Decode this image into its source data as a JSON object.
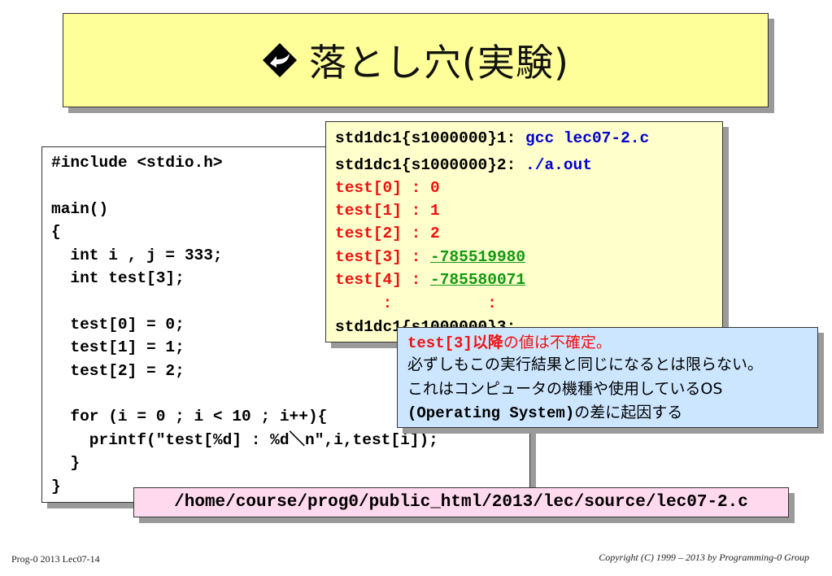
{
  "title": {
    "text": "落とし穴(実験)",
    "icon": "diamond-arrow-icon"
  },
  "code": {
    "lines": [
      "#include <stdio.h>",
      "",
      "main()",
      "{",
      "  int i , j = 333;",
      "  int test[3];",
      "",
      "  test[0] = 0;",
      "  test[1] = 1;",
      "  test[2] = 2;",
      "",
      "  for (i = 0 ; i < 10 ; i++){",
      "    printf(\"test[%d] : %d＼n\",i,test[i]);",
      "  }",
      "}"
    ]
  },
  "terminal": {
    "line1_prompt": "std1dc1{s1000000}1: ",
    "line1_cmd": "gcc lec07-2.c",
    "line2_prompt": "std1dc1{s1000000}2: ",
    "line2_cmd": "./a.out",
    "out0": "test[0] : 0",
    "out1": "test[1] : 1",
    "out2": "test[2] : 2",
    "out3_label": "test[3] : ",
    "out3_value": "-785519980",
    "out4_label": "test[4] : ",
    "out4_value": "-785580071",
    "ellipsis": "     :          :",
    "line3_prompt": "std1dc1{s1000000}3:"
  },
  "note": {
    "l1_code": "test[3]",
    "l1_red": "以降",
    "l1_rest": "の値は不確定。",
    "l2": "必ずしもこの実行結果と同じになるとは限らない。",
    "l3": "これはコンピュータの機種や使用しているOS",
    "l4_code": "(Operating System)",
    "l4_rest": "の差に起因する"
  },
  "source_path": "/home/course/prog0/public_html/2013/lec/source/lec07-2.c",
  "footer": {
    "left": "Prog-0 2013 Lec07-14",
    "right": "Copyright (C) 1999 – 2013 by Programming-0 Group"
  }
}
